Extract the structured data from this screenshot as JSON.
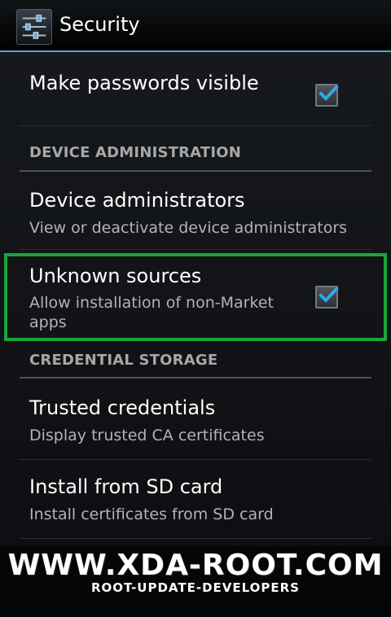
{
  "app": {
    "title": "Security",
    "icon": "settings-sliders-icon",
    "accent_color": "#4aa8d8"
  },
  "prefs": {
    "passwords_visible": {
      "title": "Make passwords visible",
      "checked": true
    },
    "device_admin_header": "DEVICE ADMINISTRATION",
    "device_admins": {
      "title": "Device administrators",
      "summary": "View or deactivate device administrators"
    },
    "unknown_sources": {
      "title": "Unknown sources",
      "summary": "Allow installation of non-Market apps",
      "checked": true,
      "highlight_color": "#1ba43a"
    },
    "credential_header": "CREDENTIAL STORAGE",
    "trusted_credentials": {
      "title": "Trusted credentials",
      "summary": "Display trusted CA certificates"
    },
    "install_sd": {
      "title": "Install from SD card",
      "summary": "Install certificates from SD card"
    }
  },
  "watermark": {
    "main": "WWW.XDA-ROOT.COM",
    "sub": "ROOT-UPDATE-DEVELOPERS"
  }
}
